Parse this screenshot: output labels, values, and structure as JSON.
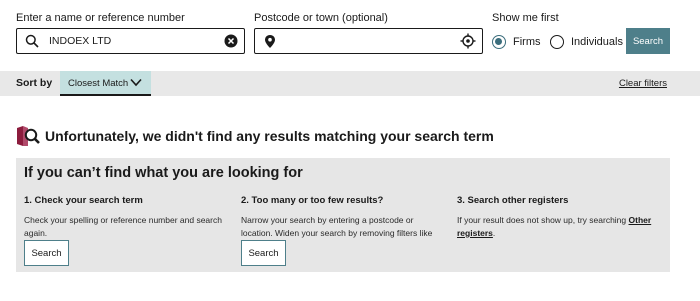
{
  "search": {
    "name_label": "Enter a name or reference number",
    "name_value": "INDOEX LTD",
    "location_label": "Postcode or town (optional)",
    "location_value": "",
    "show_label": "Show me first",
    "firms_label": "Firms",
    "individuals_label": "Individuals",
    "selected": "Firms",
    "button_label": "Search"
  },
  "sort": {
    "label": "Sort by",
    "selected": "Closest Match",
    "clear_label": "Clear filters"
  },
  "no_results": {
    "message": "Unfortunately, we didn't find any results matching your search term"
  },
  "help": {
    "title": "If you can’t find what you are looking for",
    "col1": {
      "heading": "1. Check your search term",
      "text": "Check your spelling or reference number and search again.",
      "button": "Search"
    },
    "col2": {
      "heading": "2. Too many or too few results?",
      "text": "Narrow your search by entering a postcode or location. Widen your search by removing filters like location.",
      "button": "Search"
    },
    "col3": {
      "heading": "3. Search other registers",
      "text_before": "If your result does not show up, try searching ",
      "link": "Other registers",
      "text_after": "."
    }
  },
  "colors": {
    "accent": "#4e7f8a",
    "sort_bg": "#c4e0e0",
    "panel_bg": "#e6e6e6",
    "icon_maroon": "#8c1c3d"
  }
}
